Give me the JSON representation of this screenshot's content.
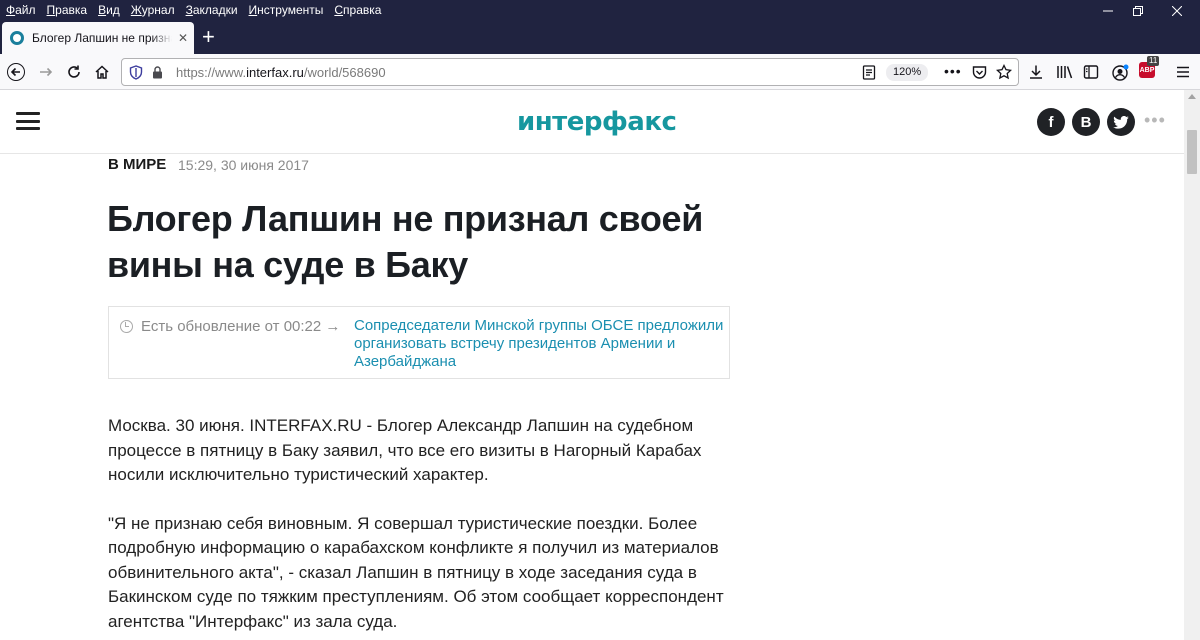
{
  "browser": {
    "menu": [
      "Файл",
      "Правка",
      "Вид",
      "Журнал",
      "Закладки",
      "Инструменты",
      "Справка"
    ],
    "tab_title": "Блогер Лапшин не признал своей",
    "url_prefix": "https://www.",
    "url_host": "interfax.ru",
    "url_path": "/world/568690",
    "zoom": "120%",
    "abp_label": "ABP",
    "abp_count": "11"
  },
  "site": {
    "logo": "интерфакс",
    "social": {
      "facebook": "f",
      "vk": "B",
      "twitter": "🐦"
    },
    "more": "•••"
  },
  "article": {
    "rubric": "В МИРЕ",
    "date": "15:29, 30 июня 2017",
    "headline": "Блогер Лапшин не признал своей вины на суде в Баку",
    "update_label": "Есть обновление от 00:22 →",
    "update_link": "Сопредседатели Минской группы ОБСЕ предложили организовать встречу президентов Армении и Азербайджана",
    "paragraphs": [
      "Москва. 30 июня. INTERFAX.RU - Блогер Александр Лапшин на судебном процессе в пятницу в Баку заявил, что все его визиты в Нагорный Карабах носили исключительно туристический характер.",
      "\"Я не признаю себя виновным. Я совершал туристические поездки. Более подробную информацию о карабахском конфликте я получил из материалов обвинительного акта\", - сказал Лапшин в пятницу в ходе заседания суда в Бакинском суде по тяжким преступлениям. Об этом сообщает корреспондент агентства \"Интерфакс\" из зала суда."
    ]
  }
}
